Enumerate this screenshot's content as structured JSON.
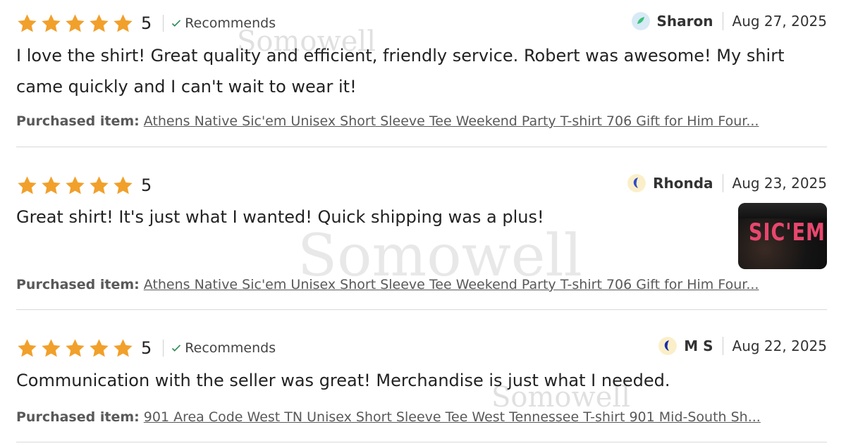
{
  "reviews": [
    {
      "rating": "5",
      "recommends": "Recommends",
      "reviewer": "Sharon",
      "date": "Aug 27, 2025",
      "text": "I love the shirt! Great quality and efficient, friendly service. Robert was awesome! My shirt came quickly and I can't wait to wear it!",
      "purchased_label": "Purchased item:",
      "purchased_item": "Athens Native Sic'em Unisex Short Sleeve Tee Weekend Party T-shirt 706 Gift for Him Four...",
      "avatar_color": "#3cbf7a"
    },
    {
      "rating": "5",
      "reviewer": "Rhonda",
      "date": "Aug 23, 2025",
      "text": "Great shirt! It's just what I wanted! Quick shipping was a plus!",
      "purchased_label": "Purchased item:",
      "purchased_item": "Athens Native Sic'em Unisex Short Sleeve Tee Weekend Party T-shirt 706 Gift for Him Four...",
      "photo_text": "SIC'EM",
      "avatar_color": "#2f4cc9"
    },
    {
      "rating": "5",
      "recommends": "Recommends",
      "reviewer": "M S",
      "date": "Aug 22, 2025",
      "text": "Communication with the seller was great! Merchandise is just what I needed.",
      "purchased_label": "Purchased item:",
      "purchased_item": "901 Area Code West TN Unisex Short Sleeve Tee West Tennessee T-shirt 901 Mid-South Sh...",
      "avatar_color": "#1b2ea8"
    }
  ],
  "watermark": "Somowell",
  "colors": {
    "star": "#f1a02b",
    "check": "#2e8b57",
    "divider": "#d9d9d9"
  },
  "icons": {
    "star": "star-icon",
    "check": "check-icon",
    "avatar": "avatar"
  }
}
